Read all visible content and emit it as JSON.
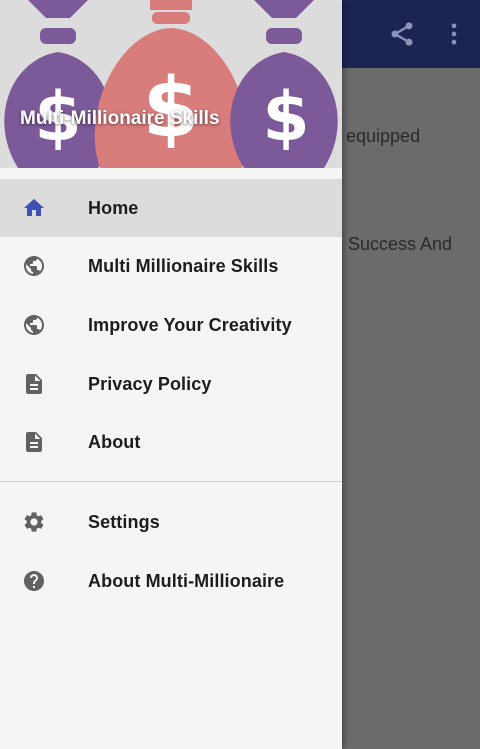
{
  "background": {
    "text_line_1": "equipped",
    "text_line_2": "Success And"
  },
  "toolbar": {
    "share_icon": "share-icon",
    "more_icon": "more-vert-icon"
  },
  "drawer": {
    "header_title": "Multi-Millionaire Skills",
    "primary_items": [
      {
        "label": "Home",
        "icon": "home-icon",
        "active": true
      },
      {
        "label": "Multi Millionaire Skills",
        "icon": "globe-icon",
        "active": false
      },
      {
        "label": "Improve Your Creativity",
        "icon": "globe-icon",
        "active": false
      },
      {
        "label": "Privacy Policy",
        "icon": "document-icon",
        "active": false
      },
      {
        "label": "About",
        "icon": "document-icon",
        "active": false
      }
    ],
    "secondary_items": [
      {
        "label": "Settings",
        "icon": "gear-icon"
      },
      {
        "label": "About Multi-Millionaire",
        "icon": "help-icon"
      }
    ]
  },
  "colors": {
    "appbar": "#1c2454",
    "active_icon": "#3f51b5",
    "inactive_icon": "#616161"
  }
}
